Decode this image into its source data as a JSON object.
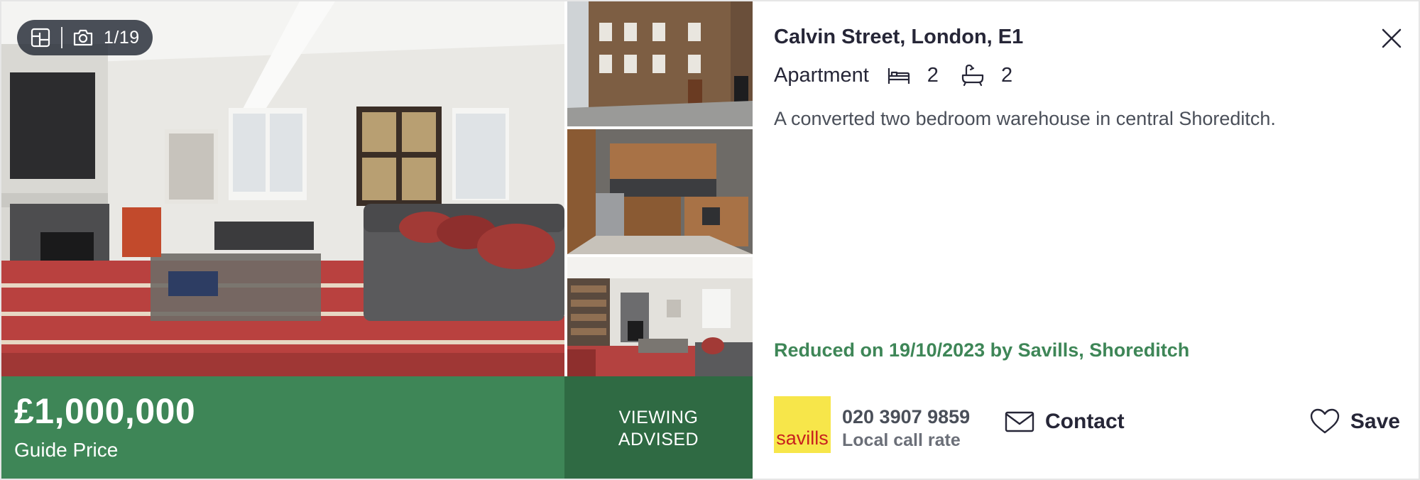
{
  "gallery": {
    "photo_counter": "1/19",
    "photos": [
      "living-room",
      "street-exterior",
      "kitchen",
      "living-room-wide"
    ]
  },
  "price_bar": {
    "price": "£1,000,000",
    "qualifier": "Guide Price",
    "viewing_line1": "VIEWING",
    "viewing_line2": "ADVISED"
  },
  "listing": {
    "address": "Calvin Street, London, E1",
    "property_type": "Apartment",
    "bedrooms": "2",
    "bathrooms": "2",
    "summary": "A converted two bedroom warehouse in central Shoreditch.",
    "reduced_note": "Reduced on 19/10/2023 by Savills, Shoreditch"
  },
  "agent": {
    "logo_text": "savills",
    "phone": "020 3907 9859",
    "call_rate": "Local call rate"
  },
  "actions": {
    "contact_label": "Contact",
    "save_label": "Save"
  },
  "colors": {
    "brand_green": "#3e8657",
    "dark_green": "#2f6a43",
    "savills_yellow": "#f7e64a",
    "savills_red": "#c8201e"
  },
  "icons": {
    "floorplan": "floorplan-icon",
    "camera": "camera-icon",
    "close": "close-icon",
    "bed": "bed-icon",
    "bath": "bath-icon",
    "mail": "envelope-icon",
    "heart": "heart-icon"
  }
}
